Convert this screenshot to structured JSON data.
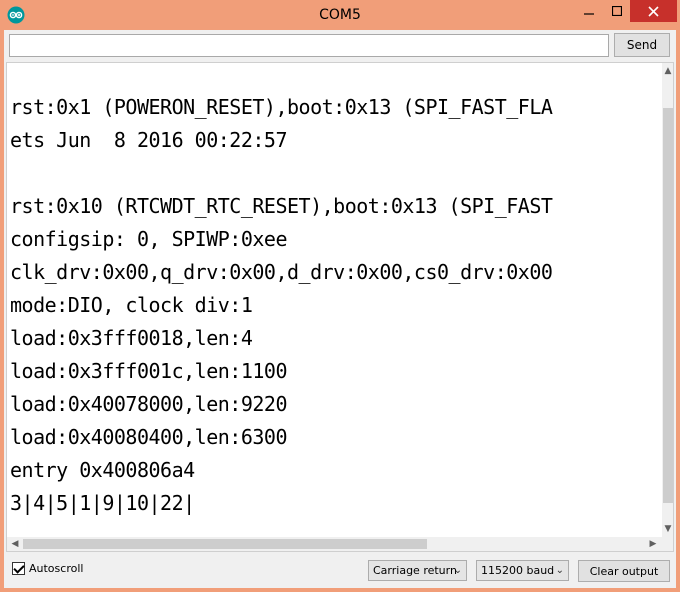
{
  "window": {
    "title": "COM5",
    "icons": {
      "app": "arduino-icon",
      "minimize": "minimize-icon",
      "maximize": "maximize-icon",
      "close": "close-icon"
    },
    "colors": {
      "titlebar": "#f19e79",
      "close": "#c7302b"
    }
  },
  "toolbar": {
    "input_value": "",
    "send_label": "Send"
  },
  "output": {
    "lines": [
      "",
      "rst:0x1 (POWERON_RESET),boot:0x13 (SPI_FAST_FLA",
      "ets Jun  8 2016 00:22:57",
      "",
      "rst:0x10 (RTCWDT_RTC_RESET),boot:0x13 (SPI_FAST",
      "configsip: 0, SPIWP:0xee",
      "clk_drv:0x00,q_drv:0x00,d_drv:0x00,cs0_drv:0x00",
      "mode:DIO, clock div:1",
      "load:0x3fff0018,len:4",
      "load:0x3fff001c,len:1100",
      "load:0x40078000,len:9220",
      "load:0x40080400,len:6300",
      "entry 0x400806a4",
      "3|4|5|1|9|10|22|"
    ]
  },
  "footer": {
    "autoscroll_label": "Autoscroll",
    "autoscroll_checked": true,
    "line_ending": "Carriage return",
    "baud": "115200 baud",
    "clear_label": "Clear output"
  }
}
